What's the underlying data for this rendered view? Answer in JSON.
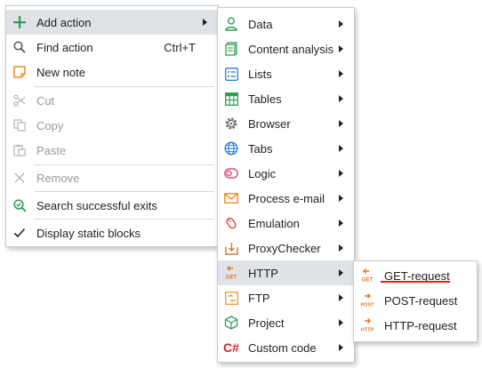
{
  "colors": {
    "accent_red": "#e0241b",
    "highlight": "#dfe3e8"
  },
  "context_menu": {
    "add_action": "Add action",
    "find_action": "Find action",
    "find_action_shortcut": "Ctrl+T",
    "new_note": "New note",
    "cut": "Cut",
    "copy": "Copy",
    "paste": "Paste",
    "remove": "Remove",
    "search_successful_exits": "Search successful exits",
    "display_static_blocks": "Display static blocks"
  },
  "add_action_menu": {
    "data": "Data",
    "content_analysis": "Content analysis",
    "lists": "Lists",
    "tables": "Tables",
    "browser": "Browser",
    "tabs": "Tabs",
    "logic": "Logic",
    "process_email": "Process e-mail",
    "emulation": "Emulation",
    "proxychecker": "ProxyChecker",
    "http": "HTTP",
    "http_icon_text": "GET",
    "ftp": "FTP",
    "project": "Project",
    "custom_code": "Custom code",
    "custom_code_icon_text": "C#"
  },
  "http_menu": {
    "get_request": "GET-request",
    "get_icon_text": "GET",
    "post_request": "POST-request",
    "post_icon_text": "POST",
    "http_request": "HTTP-request",
    "http_icon_text": "HTTP"
  }
}
